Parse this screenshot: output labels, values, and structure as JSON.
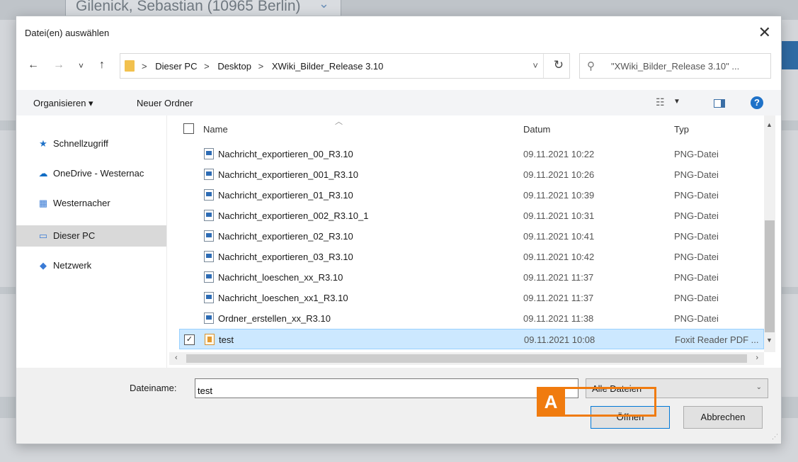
{
  "background": {
    "owner_select": "Gilenick, Sebastian (10965 Berlin)"
  },
  "dialog": {
    "title": "Datei(en) auswählen",
    "close_glyph": "✕"
  },
  "nav": {
    "back": "←",
    "forward": "→",
    "recent": "˅",
    "up": "↑",
    "breadcrumb": [
      "Dieser PC",
      "Desktop",
      "XWiki_Bilder_Release 3.10"
    ],
    "breadcrumb_sep": ">",
    "dropdown": "˅",
    "refresh": "↻",
    "search_placeholder": "\"XWiki_Bilder_Release 3.10\" ..."
  },
  "toolbar": {
    "organize": "Organisieren ▾",
    "new_folder": "Neuer Ordner",
    "view_dd": "▼",
    "help": "?"
  },
  "sidebar": {
    "items": [
      {
        "label": "Schnellzugriff",
        "icon": "star-icon",
        "glyph": "★",
        "color": "#1f72c8"
      },
      {
        "label": "OneDrive - Westernac",
        "icon": "cloud-icon",
        "glyph": "☁",
        "color": "#0f6cc4"
      },
      {
        "label": "Westernacher",
        "icon": "building-icon",
        "glyph": "▦",
        "color": "#3a7bd5"
      },
      {
        "label": "Dieser PC",
        "icon": "computer-icon",
        "glyph": "▭",
        "color": "#3a7bd5"
      },
      {
        "label": "Netzwerk",
        "icon": "network-icon",
        "glyph": "◆",
        "color": "#3a7bd5"
      }
    ],
    "selected_index": 3
  },
  "filelist": {
    "columns": {
      "name": "Name",
      "date": "Datum",
      "type": "Typ"
    },
    "rows": [
      {
        "name": "Nachricht_exportieren_00_R3.10",
        "date": "09.11.2021 10:22",
        "type": "PNG-Datei"
      },
      {
        "name": "Nachricht_exportieren_001_R3.10",
        "date": "09.11.2021 10:26",
        "type": "PNG-Datei"
      },
      {
        "name": "Nachricht_exportieren_01_R3.10",
        "date": "09.11.2021 10:39",
        "type": "PNG-Datei"
      },
      {
        "name": "Nachricht_exportieren_002_R3.10_1",
        "date": "09.11.2021 10:31",
        "type": "PNG-Datei"
      },
      {
        "name": "Nachricht_exportieren_02_R3.10",
        "date": "09.11.2021 10:41",
        "type": "PNG-Datei"
      },
      {
        "name": "Nachricht_exportieren_03_R3.10",
        "date": "09.11.2021 10:42",
        "type": "PNG-Datei"
      },
      {
        "name": "Nachricht_loeschen_xx_R3.10",
        "date": "09.11.2021 11:37",
        "type": "PNG-Datei"
      },
      {
        "name": "Nachricht_loeschen_xx1_R3.10",
        "date": "09.11.2021 11:37",
        "type": "PNG-Datei"
      },
      {
        "name": "Ordner_erstellen_xx_R3.10",
        "date": "09.11.2021 11:38",
        "type": "PNG-Datei"
      },
      {
        "name": "test",
        "date": "09.11.2021 10:08",
        "type": "Foxit Reader PDF ...",
        "selected": true,
        "checked": "✓"
      }
    ]
  },
  "footer": {
    "filename_label": "Dateiname:",
    "filename_value": "test",
    "filetype": "Alle Dateien",
    "open_button": "Öffnen",
    "cancel_button": "Abbrechen",
    "annotation_letter": "A"
  },
  "colors": {
    "accent": "#0078d7",
    "selection": "#cce8ff",
    "annotation": "#f07b0f"
  }
}
